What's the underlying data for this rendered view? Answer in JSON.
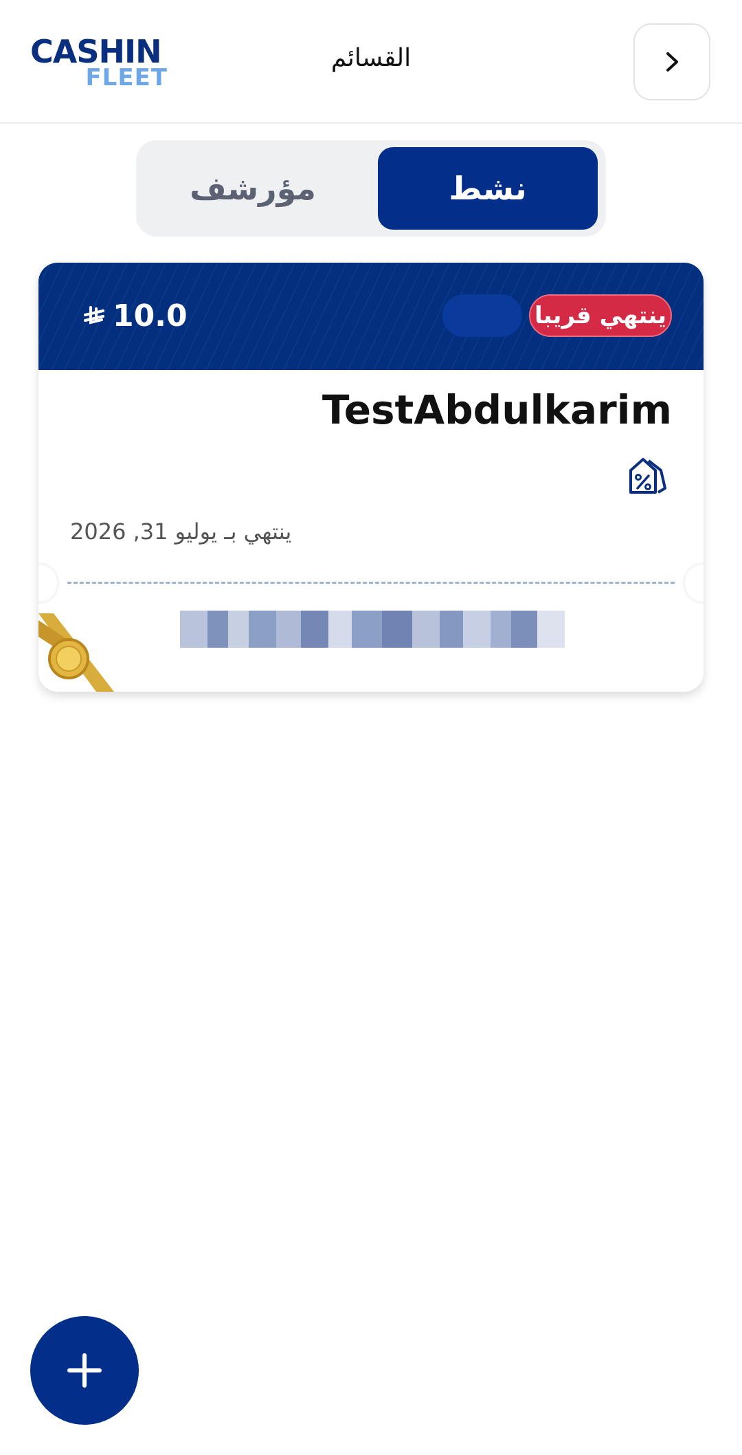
{
  "header": {
    "logo_line1": "CASHIN",
    "logo_line2": "FLEET",
    "title": "القسائم",
    "back_icon": "chevron-right-icon"
  },
  "tabs": [
    {
      "label": "نشط",
      "active": true
    },
    {
      "label": "مؤرشف",
      "active": false
    }
  ],
  "voucher": {
    "amount": "10.0",
    "currency_icon": "saudi-riyal-icon",
    "status_badge": "ينتهي قريبا",
    "name": "TestAbdulkarim",
    "discount_icon": "percent-tag-icon",
    "expiry_text": "ينتهي بـ يوليو 31, 2026",
    "code_obscured": true,
    "ribbon_icon": "gold-seal-ribbon-icon"
  },
  "fab": {
    "label": "+",
    "icon": "plus-icon"
  },
  "colors": {
    "primary": "#032f8a",
    "badge_red": "#d52a45",
    "logo_light": "#6fa7e6"
  }
}
